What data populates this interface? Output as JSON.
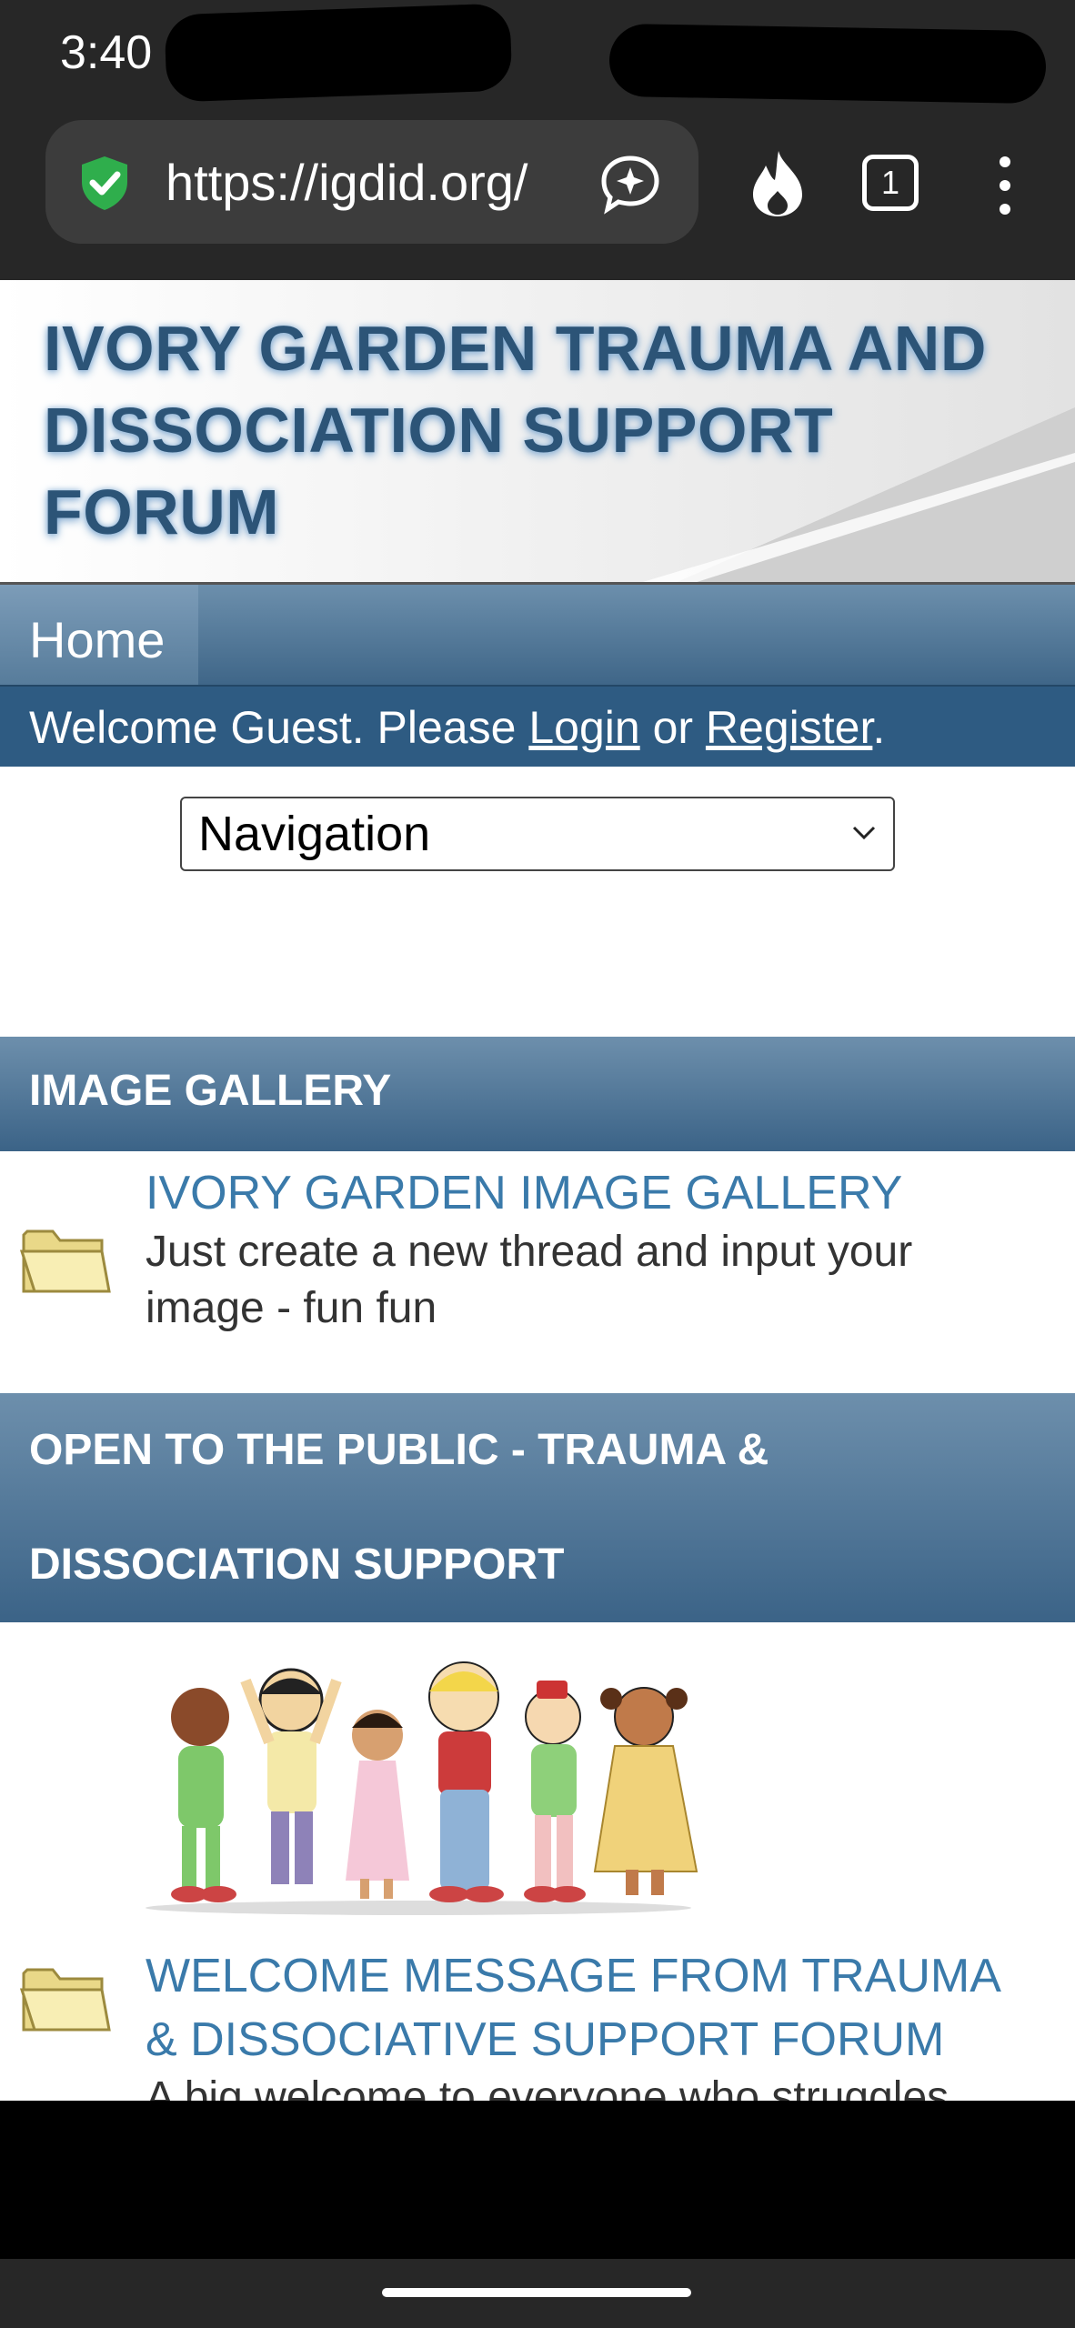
{
  "status_bar": {
    "time": "3:40"
  },
  "browser": {
    "url": "https://igdid.org/",
    "tab_count": "1"
  },
  "header": {
    "site_title": "IVORY GARDEN TRAUMA AND DISSOCIATION SUPPORT FORUM"
  },
  "navbar": {
    "home_label": "Home"
  },
  "welcome": {
    "prefix": "Welcome Guest. Please ",
    "login_label": "Login",
    "middle": " or ",
    "register_label": "Register",
    "suffix": "."
  },
  "nav_select": {
    "value": "Navigation"
  },
  "categories": [
    {
      "title": "IMAGE GALLERY",
      "forums": [
        {
          "title": "IVORY GARDEN IMAGE GALLERY",
          "description": "Just create a new thread and input your image - fun fun"
        }
      ]
    },
    {
      "title_line1": "OPEN TO THE PUBLIC - TRAUMA &",
      "title_line2": "DISSOCIATION SUPPORT",
      "forums": [
        {
          "title_line1": "WELCOME MESSAGE FROM TRAUMA",
          "title_line2": "& DISSOCIATIVE SUPPORT FORUM",
          "description": "A big welcome to everyone who struggles"
        }
      ]
    }
  ],
  "colors": {
    "brand_blue": "#2c5477",
    "link_blue": "#3a7aaa",
    "bar_blue": "#2e5b82"
  }
}
